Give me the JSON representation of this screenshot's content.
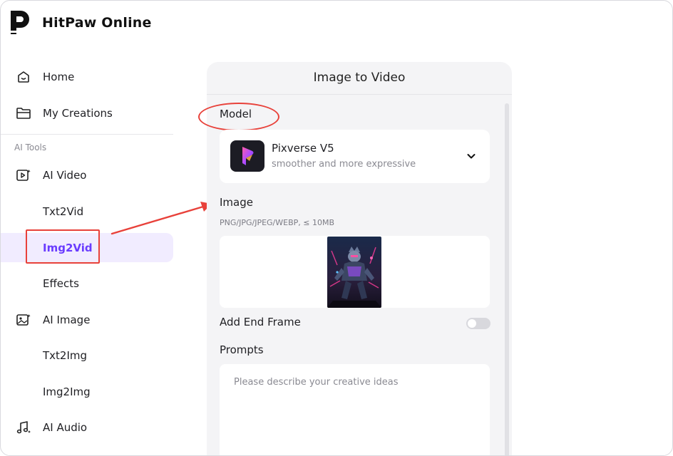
{
  "app": {
    "title": "HitPaw Online"
  },
  "sidebar": {
    "items": [
      {
        "label": "Home",
        "icon": "home-icon"
      },
      {
        "label": "My Creations",
        "icon": "folder-icon"
      }
    ],
    "section_label": "AI Tools",
    "tools": [
      {
        "label": "AI Video",
        "icon": "ai-video-icon"
      },
      {
        "label": "Txt2Vid"
      },
      {
        "label": "Img2Vid",
        "active": true
      },
      {
        "label": "Effects"
      },
      {
        "label": "AI Image",
        "icon": "ai-image-icon"
      },
      {
        "label": "Txt2Img"
      },
      {
        "label": "Img2Img"
      },
      {
        "label": "AI Audio",
        "icon": "ai-audio-icon"
      }
    ]
  },
  "panel": {
    "title": "Image to Video",
    "model": {
      "label": "Model",
      "name": "Pixverse V5",
      "description": "smoother and more expressive"
    },
    "image": {
      "label": "Image",
      "hint": "PNG/JPG/JPEG/WEBP, ≤ 10MB"
    },
    "end_frame": {
      "label": "Add End Frame",
      "enabled": false
    },
    "prompts": {
      "label": "Prompts",
      "placeholder": "Please describe your creative ideas"
    }
  },
  "colors": {
    "accent": "#6a3cff",
    "annotation": "#e8413a",
    "panel_bg": "#f4f4f6"
  }
}
